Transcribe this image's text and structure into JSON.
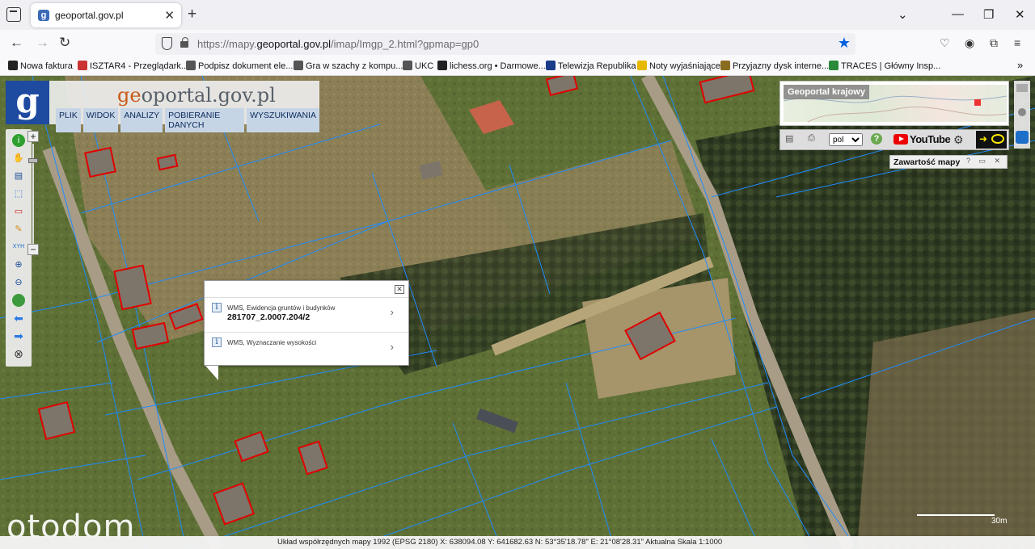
{
  "browser": {
    "tab_title": "geoportal.gov.pl",
    "url_prefix": "https://mapy.",
    "url_domain": "geoportal.gov.pl",
    "url_suffix": "/imap/Imgp_2.html?gpmap=gp0"
  },
  "bookmarks": [
    {
      "label": "Nowa faktura",
      "icon": "f-icon",
      "color": "#222"
    },
    {
      "label": "ISZTAR4 - Przeglądark...",
      "icon": "isztar-icon",
      "color": "#c33"
    },
    {
      "label": "Podpisz dokument ele...",
      "icon": "globe-icon",
      "color": "#555"
    },
    {
      "label": "Gra w szachy z kompu...",
      "icon": "chess-icon",
      "color": "#555"
    },
    {
      "label": "UKC",
      "icon": "globe-icon",
      "color": "#555"
    },
    {
      "label": "lichess.org • Darmowe...",
      "icon": "lichess-icon",
      "color": "#222"
    },
    {
      "label": "Telewizja Republika",
      "icon": "tv-icon",
      "color": "#1a3a8a"
    },
    {
      "label": "Noty wyjaśniające",
      "icon": "bulb-icon",
      "color": "#e6b800"
    },
    {
      "label": "Przyjazny dysk interne...",
      "icon": "drive-icon",
      "color": "#8a6d1f"
    },
    {
      "label": "TRACES | Główny Insp...",
      "icon": "traces-icon",
      "color": "#2a8a3a"
    }
  ],
  "geoportal": {
    "logo_part1": "ge",
    "logo_part2": "oportal.gov.pl",
    "menu": [
      "PLIK",
      "WIDOK",
      "ANALIZY",
      "POBIERANIE DANYCH",
      "WYSZUKIWANIA"
    ],
    "overview_title": "Geoportal krajowy",
    "language": "pol",
    "youtube_label": "YouTube",
    "map_contents_title": "Zawartość mapy",
    "map_contents_buttons": "? ▭ ✕"
  },
  "popup": {
    "rows": [
      {
        "label": "WMS, Ewidencja gruntów i budynków",
        "value": "281707_2.0007.204/2"
      },
      {
        "label": "WMS, Wyznaczanie wysokości",
        "value": ""
      }
    ]
  },
  "status": {
    "text": "Układ współrzędnych mapy 1992 (EPSG 2180)   X: 638094.08  Y: 641682.63    N: 53°35'18.78\"  E: 21°08'28.31\"  Aktualna Skala 1:1000",
    "scale_label": "30m"
  },
  "watermark": "otodom"
}
